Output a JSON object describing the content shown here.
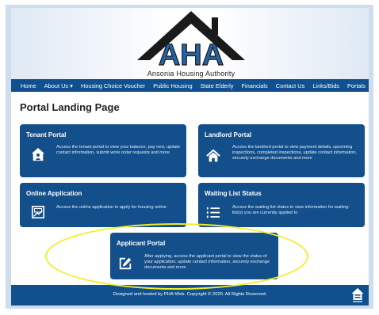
{
  "header": {
    "logo_letters": "AHA",
    "logo_name": "Ansonia Housing Authority"
  },
  "nav": {
    "items": [
      "Home",
      "About Us ▾",
      "Housing Choice Voucher",
      "Public Housing",
      "State Elderly",
      "Financials",
      "Contact Us",
      "Links/Bids",
      "Portals"
    ]
  },
  "page_title": "Portal Landing Page",
  "cards": {
    "tenant": {
      "title": "Tenant Portal",
      "description": "Access the tenant portal to view your balance, pay rent, update contact information, submit work order requests and more",
      "icon": "house-person-icon"
    },
    "landlord": {
      "title": "Landlord Portal",
      "description": "Access the landlord portal to view payment details, upcoming inspections, completed inspections, update contact information, securely exchange documents and more",
      "icon": "house-icon"
    },
    "online_application": {
      "title": "Online Application",
      "description": "Access the online application to apply for housing online",
      "icon": "application-form-icon"
    },
    "waiting_list": {
      "title": "Waiting List Status",
      "description": "Access the waiting list status to view information for waiting list(s) you are currently applied to",
      "icon": "numbered-list-icon"
    },
    "applicant": {
      "title": "Applicant Portal",
      "description": "After applying, access the applicant portal to view the status of your application, update contact information, securely exchange documents and more",
      "icon": "edit-icon"
    }
  },
  "footer": {
    "text": "Designed and hosted by PHA-Web. Copyright © 2020. All Rights Reserved.",
    "icon": "equal-housing-icon"
  },
  "colors": {
    "nav_bg": "#10508f",
    "card_bg": "#134f8a",
    "highlight": "#f1ee2a"
  }
}
